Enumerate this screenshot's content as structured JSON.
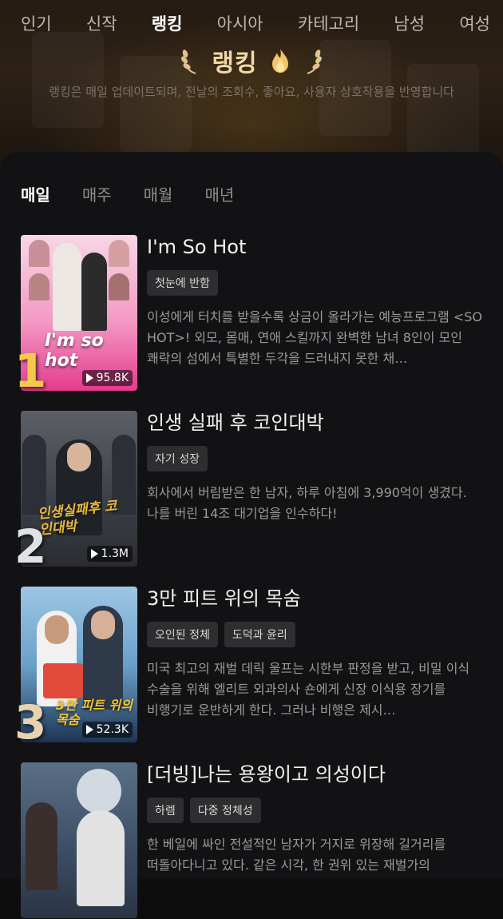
{
  "nav": [
    "인기",
    "신작",
    "랭킹",
    "아시아",
    "카테고리",
    "남성",
    "여성"
  ],
  "nav_active_index": 2,
  "page_title": "랭킹",
  "page_subtitle": "랭킹은 매일 업데이트되며, 전날의 조회수, 좋아요, 사용자 상호작용을 반영합니다",
  "tabs": [
    "매일",
    "매주",
    "매월",
    "매년"
  ],
  "tab_active_index": 0,
  "items": [
    {
      "rank": "1",
      "title": "I'm So Hot",
      "tags": [
        "첫눈에 반함"
      ],
      "description": "이성에게 터치를 받을수록 상금이 올라가는 예능프로그램 <SO HOT>! 외모, 몸매, 연애 스킬까지 완벽한 남녀 8인이 모인 쾌락의 섬에서 특별한 두각을 드러내지 못한 채…",
      "views": "95.8K",
      "cover_text": "I'm so hot"
    },
    {
      "rank": "2",
      "title": "인생 실패 후 코인대박",
      "tags": [
        "자기 성장"
      ],
      "description": "회사에서 버림받은 한 남자, 하루 아침에 3,990억이 생겼다. 나를 버린 14조 대기업을 인수하다!",
      "views": "1.3M",
      "cover_text": "인생실패후 코인대박"
    },
    {
      "rank": "3",
      "title": "3만 피트 위의 목숨",
      "tags": [
        "오인된 정체",
        "도덕과 윤리"
      ],
      "description": "미국 최고의 재벌 데릭 울프는 시한부 판정을 받고, 비밀 이식 수술을 위해 엘리트 외과의사 숀에게 신장 이식용 장기를 비행기로 운반하게 한다. 그러나 비행은 제시…",
      "views": "52.3K",
      "cover_text": "3만 피트 위의 목숨"
    },
    {
      "rank": "",
      "title": "[더빙]나는 용왕이고 의성이다",
      "tags": [
        "하렘",
        "다중 정체성"
      ],
      "description": "한 베일에 싸인 전설적인 남자가 거지로 위장해 길거리를 떠돌아다니고 있다. 같은 시각, 한 권위 있는 재벌가의",
      "views": "",
      "cover_text": ""
    }
  ]
}
